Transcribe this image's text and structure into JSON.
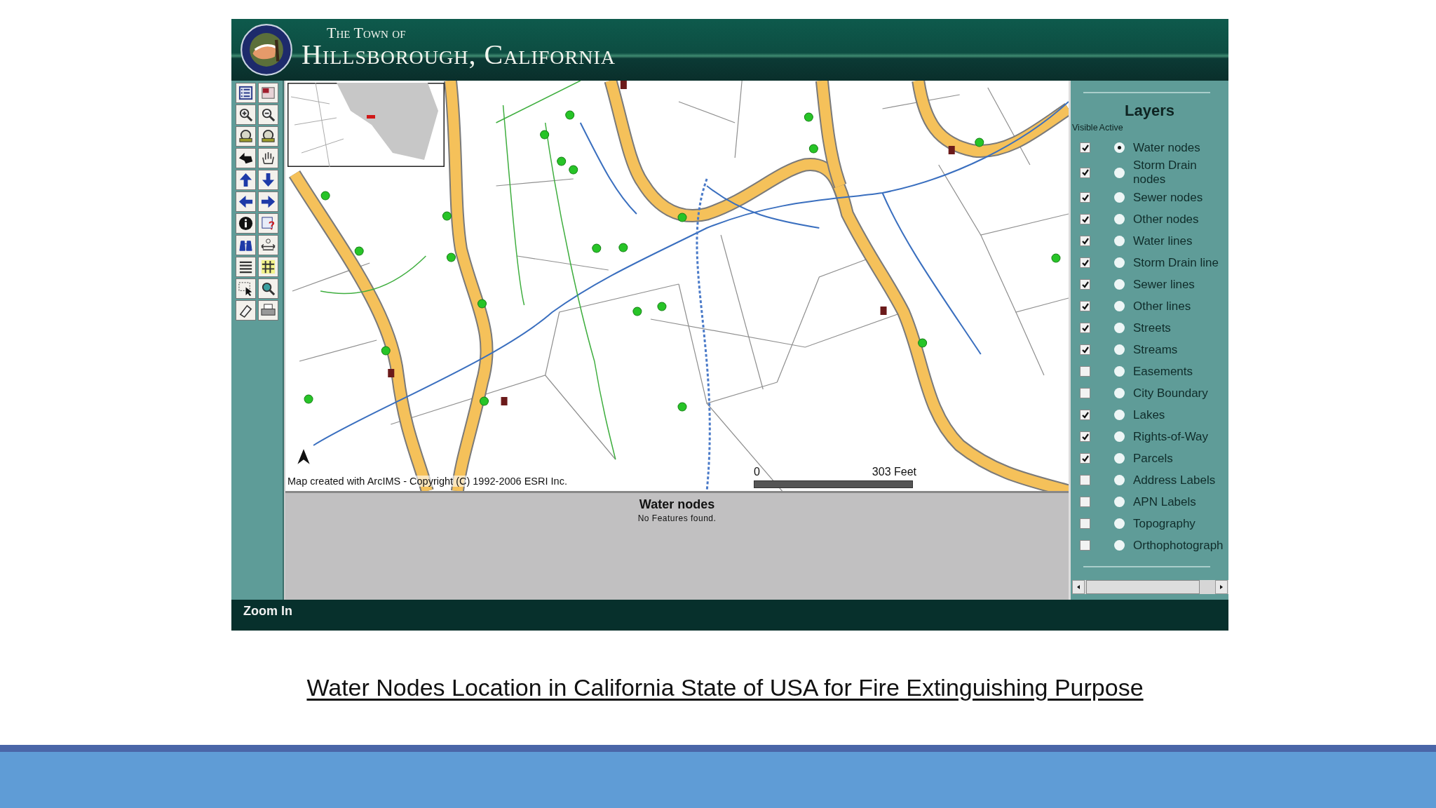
{
  "header": {
    "subtitle": "The Town of",
    "title": "Hillsborough, California"
  },
  "map": {
    "copyright": "Map created with ArcIMS - Copyright (C) 1992-2006 ESRI Inc.",
    "scale_start": "0",
    "scale_end": "303 Feet"
  },
  "results": {
    "title": "Water nodes",
    "message": "No Features found."
  },
  "layers": {
    "title": "Layers",
    "visible_heading": "Visible",
    "active_heading": "Active",
    "items": [
      {
        "label": "Water nodes",
        "visible": true,
        "selected": true
      },
      {
        "label": "Storm Drain nodes",
        "visible": true,
        "selected": false
      },
      {
        "label": "Sewer nodes",
        "visible": true,
        "selected": false
      },
      {
        "label": "Other nodes",
        "visible": true,
        "selected": false
      },
      {
        "label": "Water lines",
        "visible": true,
        "selected": false
      },
      {
        "label": "Storm Drain line",
        "visible": true,
        "selected": false
      },
      {
        "label": "Sewer lines",
        "visible": true,
        "selected": false
      },
      {
        "label": "Other lines",
        "visible": true,
        "selected": false
      },
      {
        "label": "Streets",
        "visible": true,
        "selected": false
      },
      {
        "label": "Streams",
        "visible": true,
        "selected": false
      },
      {
        "label": "Easements",
        "visible": false,
        "selected": false
      },
      {
        "label": "City Boundary",
        "visible": false,
        "selected": false
      },
      {
        "label": "Lakes",
        "visible": true,
        "selected": false
      },
      {
        "label": "Rights-of-Way",
        "visible": true,
        "selected": false
      },
      {
        "label": "Parcels",
        "visible": true,
        "selected": false
      },
      {
        "label": "Address Labels",
        "visible": false,
        "selected": false
      },
      {
        "label": "APN Labels",
        "visible": false,
        "selected": false
      },
      {
        "label": "Topography",
        "visible": false,
        "selected": false
      },
      {
        "label": "Orthophotograph",
        "visible": false,
        "selected": false
      }
    ]
  },
  "status_bar": {
    "text": "Zoom In"
  },
  "caption": "Water Nodes Location in California State of USA for Fire Extinguishing Purpose"
}
